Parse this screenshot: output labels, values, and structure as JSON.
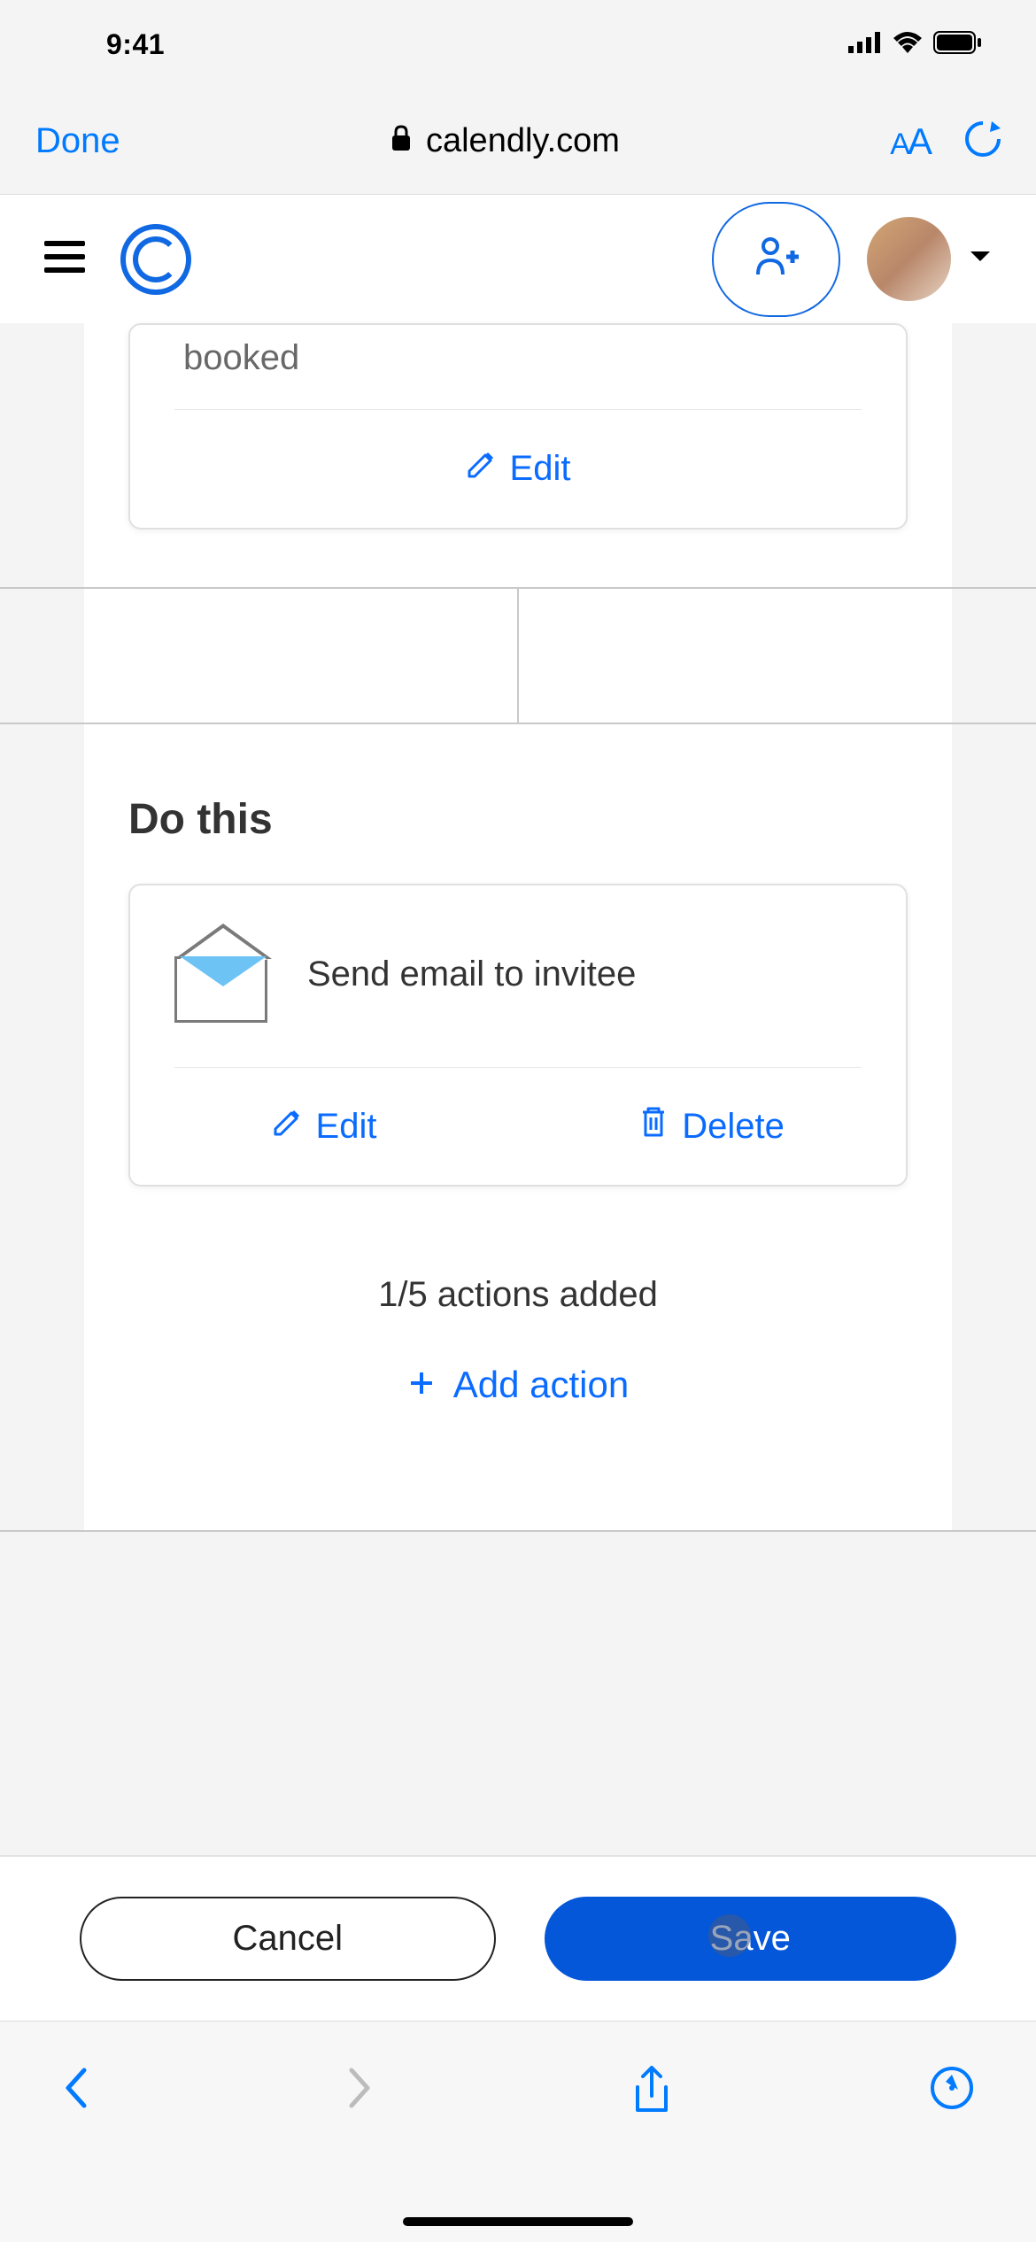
{
  "status": {
    "time": "9:41"
  },
  "browser": {
    "done_label": "Done",
    "url": "calendly.com",
    "aa_label_small": "A",
    "aa_label_big": "A"
  },
  "trigger": {
    "partial_text": "booked",
    "edit_label": "Edit"
  },
  "do_this": {
    "heading": "Do this",
    "action": {
      "title": "Send email to invitee",
      "edit_label": "Edit",
      "delete_label": "Delete"
    },
    "count_text": "1/5 actions added",
    "add_label": "Add action"
  },
  "footer": {
    "cancel_label": "Cancel",
    "save_label": "Save"
  }
}
